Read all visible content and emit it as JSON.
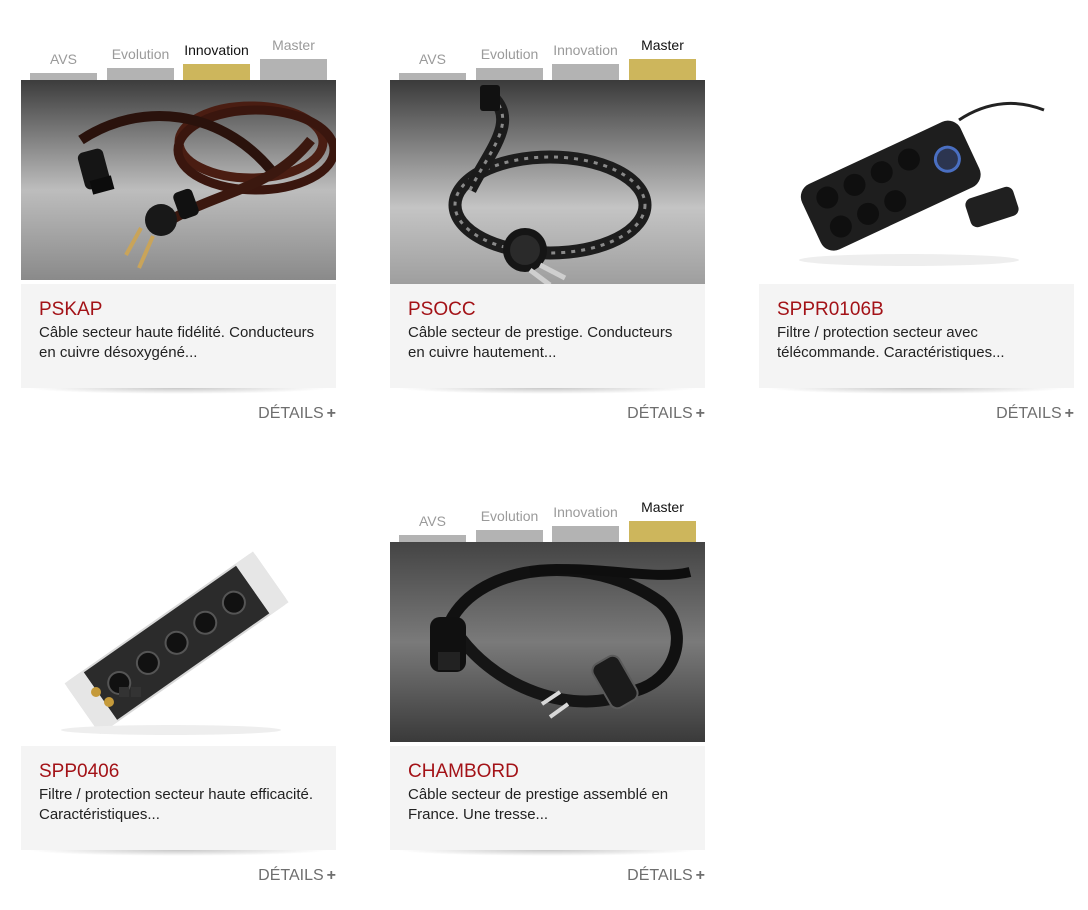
{
  "products": [
    {
      "name": "PSKAP",
      "description": "Câble secteur haute fidélité. Conducteurs en cuivre désoxygéné...",
      "details_label": "DÉTAILS",
      "details_plus": "+",
      "image": "power-cable-photo",
      "ranges": [
        {
          "label": "AVS",
          "active": false
        },
        {
          "label": "Evolution",
          "active": false
        },
        {
          "label": "Innovation",
          "active": true
        },
        {
          "label": "Master",
          "active": false
        }
      ]
    },
    {
      "name": "PSOCC",
      "description": "Câble secteur de prestige. Conducteurs en cuivre hautement...",
      "details_label": "DÉTAILS",
      "details_plus": "+",
      "image": "braided-power-cable-photo",
      "ranges": [
        {
          "label": "AVS",
          "active": false
        },
        {
          "label": "Evolution",
          "active": false
        },
        {
          "label": "Innovation",
          "active": false
        },
        {
          "label": "Master",
          "active": true
        }
      ]
    },
    {
      "name": "SPPR0106B",
      "description": "Filtre / protection secteur avec télécommande. Caractéristiques...",
      "details_label": "DÉTAILS",
      "details_plus": "+",
      "image": "power-strip-remote-photo"
    },
    {
      "name": "SPP0406",
      "description": "Filtre / protection secteur haute efficacité. Caractéristiques...",
      "details_label": "DÉTAILS",
      "details_plus": "+",
      "image": "power-filter-block-photo"
    },
    {
      "name": "CHAMBORD",
      "description": "Câble secteur de prestige assemblé en France. Une tresse...",
      "details_label": "DÉTAILS",
      "details_plus": "+",
      "image": "prestige-power-cable-photo",
      "ranges": [
        {
          "label": "AVS",
          "active": false
        },
        {
          "label": "Evolution",
          "active": false
        },
        {
          "label": "Innovation",
          "active": false
        },
        {
          "label": "Master",
          "active": true
        }
      ]
    }
  ],
  "colors": {
    "product_name": "#a31217",
    "active_range": "#cdb65c",
    "inactive_range": "#b3b3b3",
    "info_background": "#f4f4f4"
  }
}
